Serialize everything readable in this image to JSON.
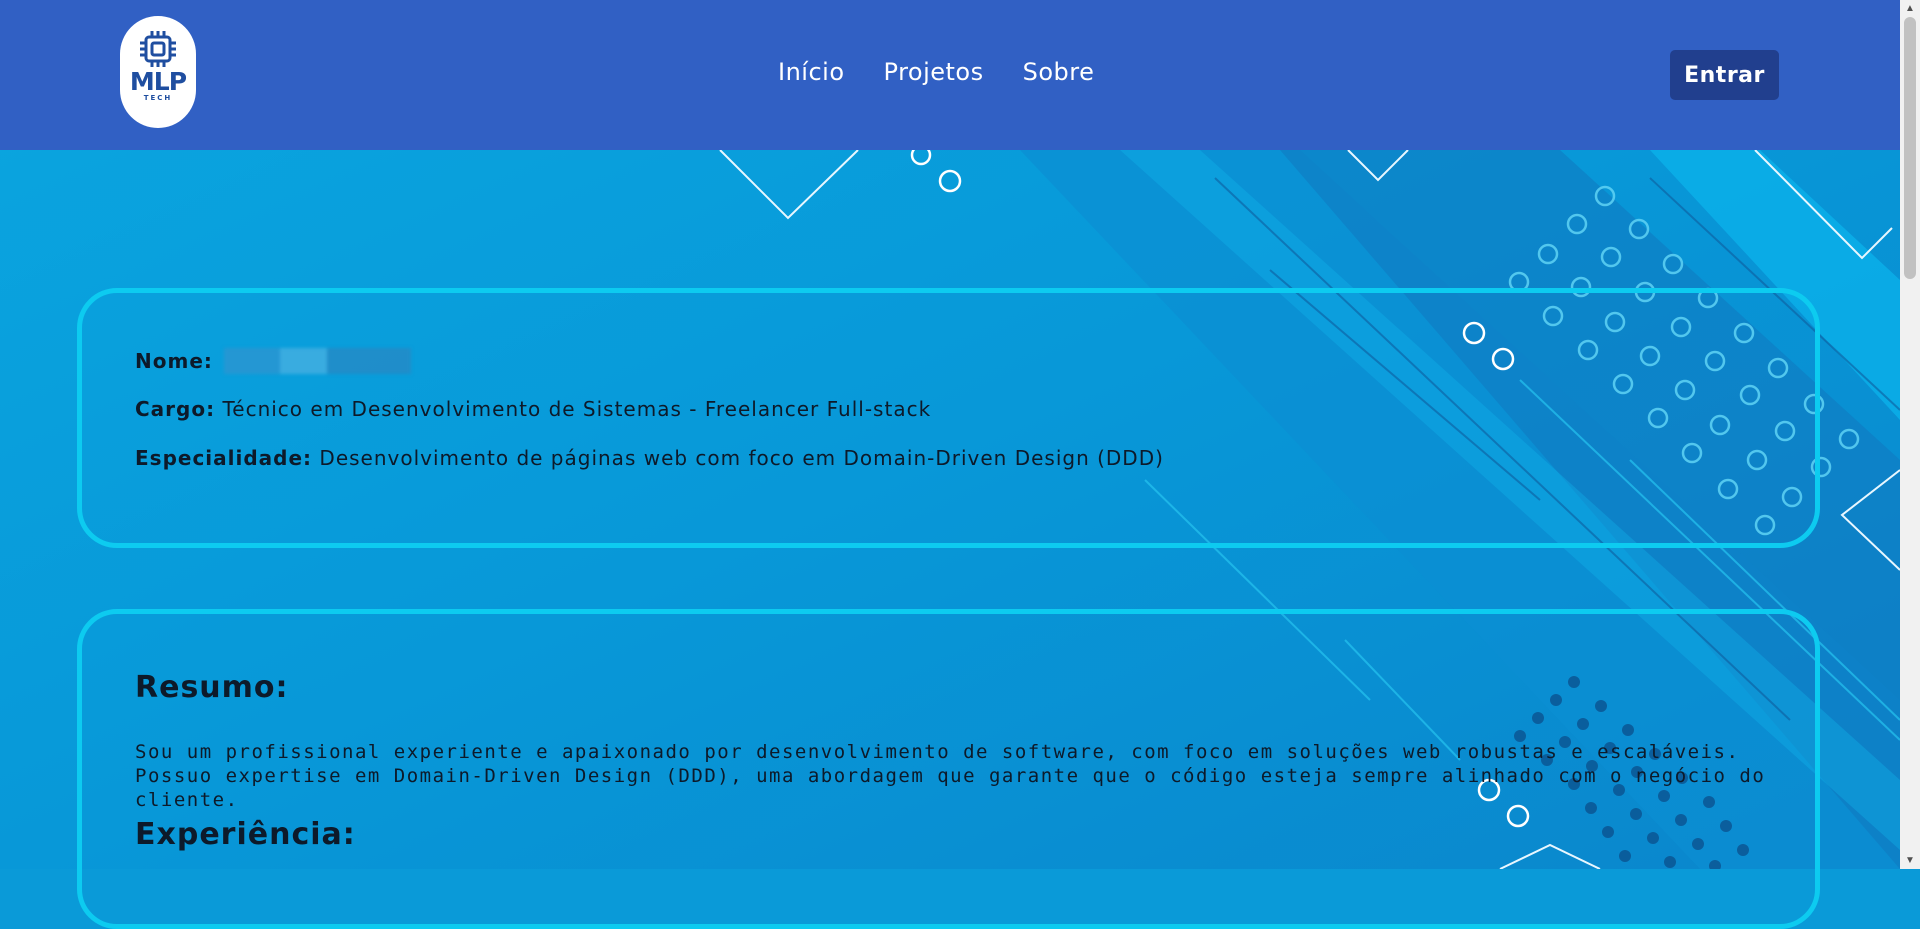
{
  "brand": {
    "name": "MLP",
    "tagline": "TECH"
  },
  "nav": {
    "items": [
      {
        "label": "Início"
      },
      {
        "label": "Projetos"
      },
      {
        "label": "Sobre"
      }
    ]
  },
  "header": {
    "login_label": "Entrar"
  },
  "profile": {
    "name_label": "Nome:",
    "role_label": "Cargo:",
    "role_value": "Técnico em Desenvolvimento de Sistemas - Freelancer Full-stack",
    "specialty_label": "Especialidade:",
    "specialty_value": "Desenvolvimento de páginas web com foco em Domain-Driven Design (DDD)"
  },
  "summary": {
    "title": "Resumo:",
    "text": "Sou um profissional experiente e apaixonado por desenvolvimento de software, com foco em soluções web robustas e escaláveis. Possuo expertise em Domain-Driven Design (DDD), uma abordagem que garante que o código esteja sempre alinhado com o negócio do cliente."
  },
  "experience": {
    "title": "Experiência:"
  },
  "colors": {
    "header_bg": "#3160c4",
    "login_bg": "#213f8e",
    "page_bg": "#0a9ad8",
    "card_border": "#0dcbf0"
  }
}
